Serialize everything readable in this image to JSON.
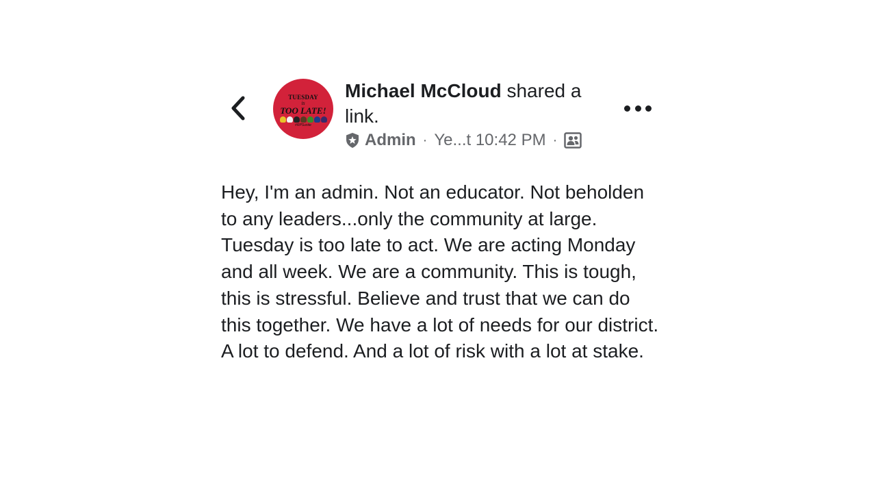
{
  "header": {
    "author_name": "Michael McCloud",
    "action_text": " shared a link.",
    "role_label": "Admin",
    "timestamp": "Ye...t 10:42 PM",
    "separator": "·",
    "avatar": {
      "line1": "TUESDAY",
      "line2": "is",
      "line3": "TOO LATE!",
      "line4": "#RPSunite",
      "background": "#d2223a"
    }
  },
  "icons": {
    "back": "chevron-left-icon",
    "role": "admin-shield-icon",
    "audience": "group-icon",
    "more": "more-dots-icon"
  },
  "post": {
    "text": "Hey, I'm an admin. Not an educator. Not beholden to any leaders...only the community at large. Tuesday is too late to act. We are acting Monday and all week. We are a community. This is tough, this is stressful. Believe and trust that we can do this together. We have a lot of needs for our district. A lot to defend. And a lot of risk with a lot at stake."
  },
  "colors": {
    "text_primary": "#1c1e21",
    "text_secondary": "#65676b"
  }
}
